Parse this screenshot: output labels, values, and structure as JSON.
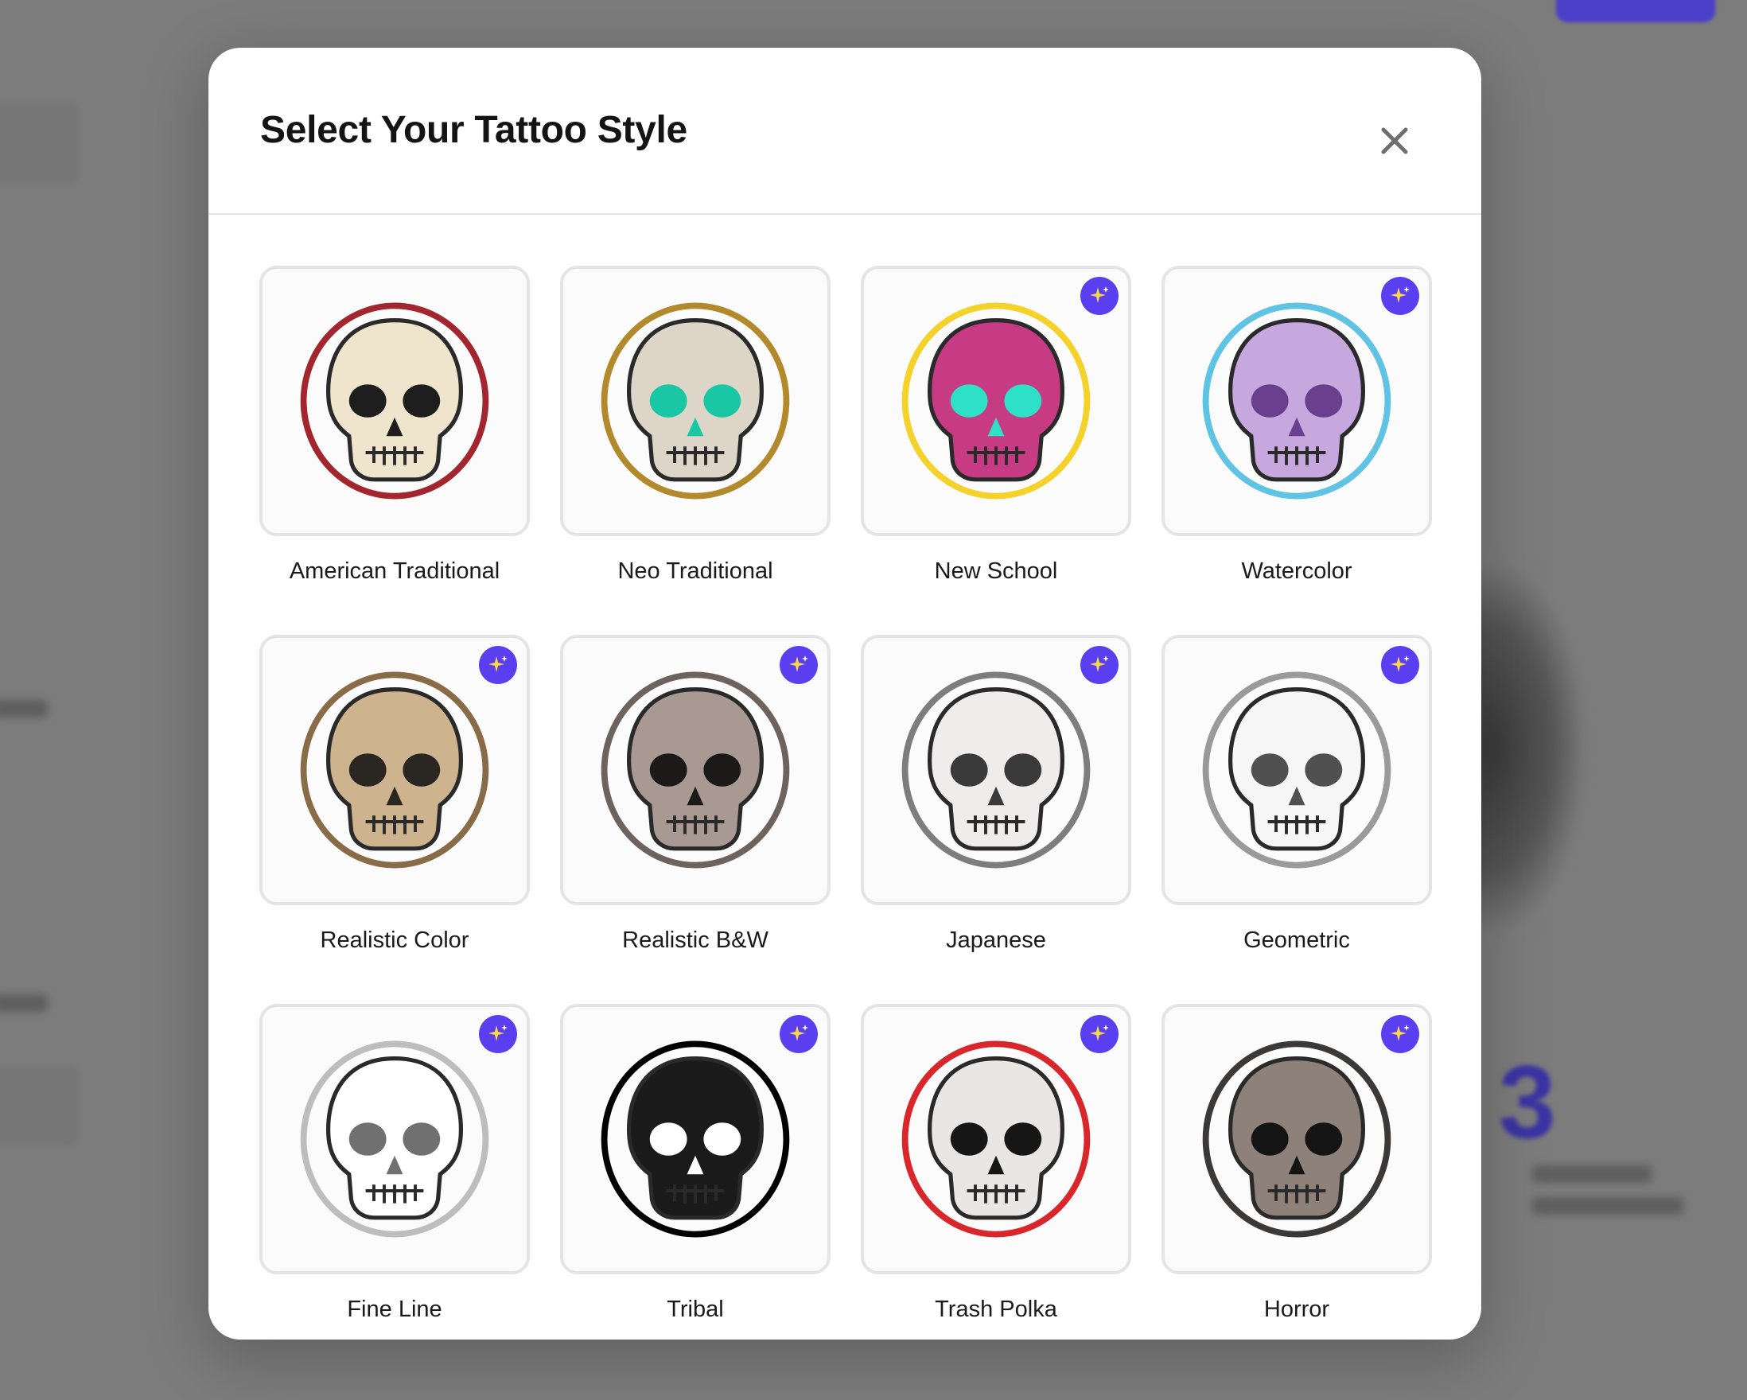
{
  "modal": {
    "title": "Select Your Tattoo Style",
    "close_icon": "close-icon",
    "styles": [
      {
        "label": "American Traditional",
        "ai": false,
        "skull": "#efe4cc",
        "accent": "#a3262e",
        "eye": "#1e1e1e"
      },
      {
        "label": "Neo Traditional",
        "ai": false,
        "skull": "#ddd6c8",
        "accent": "#b28a2c",
        "eye": "#19c7a4"
      },
      {
        "label": "New School",
        "ai": true,
        "skull": "#c73a84",
        "accent": "#f5d22a",
        "eye": "#2de0c6"
      },
      {
        "label": "Watercolor",
        "ai": true,
        "skull": "#c6a7de",
        "accent": "#5fc3e4",
        "eye": "#6a3f8e"
      },
      {
        "label": "Realistic Color",
        "ai": true,
        "skull": "#cdb48f",
        "accent": "#8a6b48",
        "eye": "#2a2722"
      },
      {
        "label": "Realistic B&W",
        "ai": true,
        "skull": "#a89a92",
        "accent": "#6e625c",
        "eye": "#1c1a19"
      },
      {
        "label": "Japanese",
        "ai": true,
        "skull": "#f1ecec",
        "accent": "#7d7d7d",
        "eye": "#3a3a3a"
      },
      {
        "label": "Geometric",
        "ai": true,
        "skull": "#f6f6f6",
        "accent": "#9a9a9a",
        "eye": "#505050"
      },
      {
        "label": "Fine Line",
        "ai": true,
        "skull": "#ffffff",
        "accent": "#bdbdbd",
        "eye": "#707070"
      },
      {
        "label": "Tribal",
        "ai": true,
        "skull": "#1a1a1a",
        "accent": "#000000",
        "eye": "#ffffff"
      },
      {
        "label": "Trash Polka",
        "ai": true,
        "skull": "#e9e6e3",
        "accent": "#d8262a",
        "eye": "#161616"
      },
      {
        "label": "Horror",
        "ai": true,
        "skull": "#8d8179",
        "accent": "#3b3836",
        "eye": "#141414"
      }
    ]
  },
  "colors": {
    "brand": "#5a3ff0",
    "overlay": "#7c7c7c"
  },
  "background": {
    "big_number": "3"
  }
}
